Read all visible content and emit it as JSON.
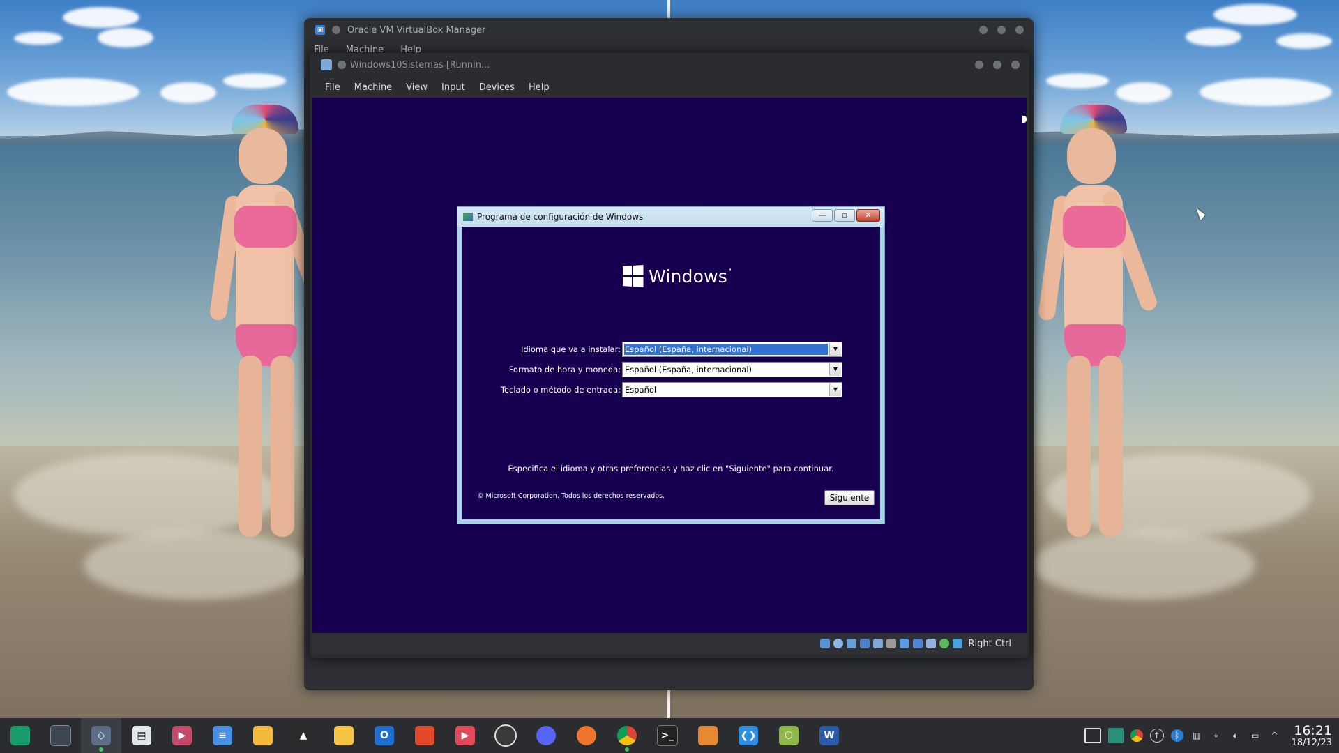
{
  "vbox_manager": {
    "title": "Oracle VM VirtualBox Manager",
    "menu": [
      "File",
      "Machine",
      "Help"
    ]
  },
  "vm_window": {
    "title": "Windows10Sistemas [Runnin...",
    "menu": [
      "File",
      "Machine",
      "View",
      "Input",
      "Devices",
      "Help"
    ],
    "host_key": "Right Ctrl",
    "status_icons": [
      "hard-disk-icon",
      "optical-drive-icon",
      "audio-icon",
      "network-icon",
      "usb-icon",
      "shared-folders-icon",
      "display-icon",
      "video-capture-icon",
      "cpu-icon",
      "mouse-integration-icon",
      "keyboard-icon"
    ]
  },
  "setup_dialog": {
    "title": "Programa de configuración de Windows",
    "logo_text": "Windows",
    "fields": [
      {
        "label": "Idioma que va a instalar:",
        "value": "Español (España, internacional)",
        "focused": true
      },
      {
        "label": "Formato de hora y moneda:",
        "value": "Español (España, internacional)",
        "focused": false
      },
      {
        "label": "Teclado o método de entrada:",
        "value": "Español",
        "focused": false
      }
    ],
    "hint": "Especifica el idioma y otras preferencias y haz clic en \"Siguiente\" para continuar.",
    "copyright": "© Microsoft Corporation. Todos los derechos reservados.",
    "next_label": "Siguiente"
  },
  "taskbar": {
    "apps": [
      {
        "name": "manjaro-menu-icon",
        "color": "#1a9b6c"
      },
      {
        "name": "system-monitor-icon",
        "color": "#3c4650"
      },
      {
        "name": "virtualbox-icon",
        "color": "#5b6e86"
      },
      {
        "name": "software-store-icon",
        "color": "#e3e6ea"
      },
      {
        "name": "video-editor-icon",
        "color": "#c64a6a"
      },
      {
        "name": "notes-icon",
        "color": "#4a90e2"
      },
      {
        "name": "file-manager-icon",
        "color": "#f2b93a"
      },
      {
        "name": "inkscape-icon",
        "color": "#2b2b2b"
      },
      {
        "name": "files-icon",
        "color": "#f6c443"
      },
      {
        "name": "outlook-icon",
        "color": "#1f6fd1"
      },
      {
        "name": "office-icon",
        "color": "#e04a2b"
      },
      {
        "name": "media-player-icon",
        "color": "#e24a5b"
      },
      {
        "name": "obs-icon",
        "color": "#3a3a3a"
      },
      {
        "name": "discord-icon",
        "color": "#5865f2"
      },
      {
        "name": "firefox-icon",
        "color": "#f0742b"
      },
      {
        "name": "chrome-icon",
        "color": "#db4437"
      },
      {
        "name": "terminal-icon",
        "color": "#232323"
      },
      {
        "name": "archive-manager-icon",
        "color": "#e58a32"
      },
      {
        "name": "vscode-icon",
        "color": "#2b8ee2"
      },
      {
        "name": "3d-cube-icon",
        "color": "#8fb84a"
      },
      {
        "name": "word-icon",
        "color": "#2a5ba8"
      }
    ],
    "time": "16:21",
    "date": "18/12/23"
  }
}
